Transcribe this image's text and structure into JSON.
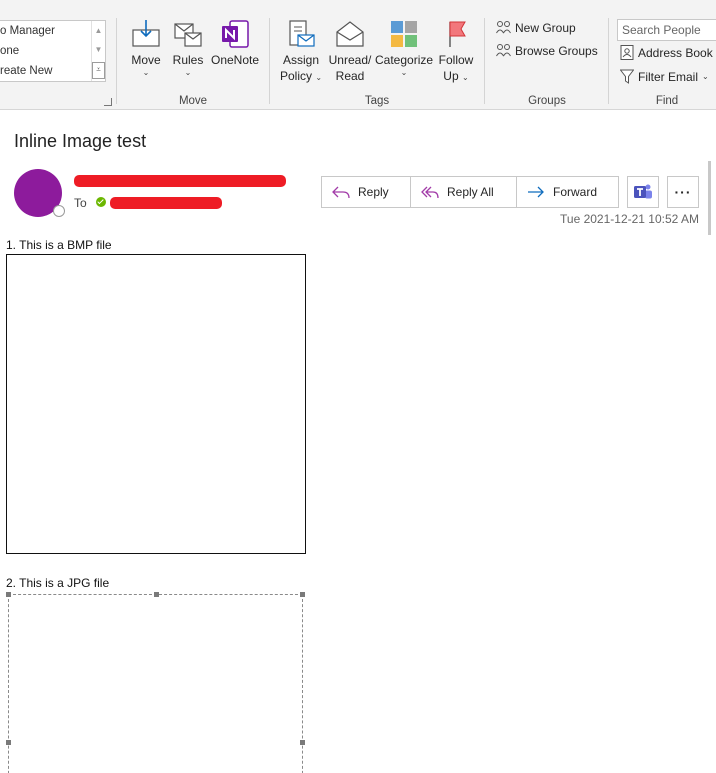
{
  "ribbon": {
    "quick_steps": {
      "items": [
        "o Manager",
        "one",
        "reate New"
      ],
      "scroll_up": "▲",
      "scroll_down": "▼",
      "more": "⩡"
    },
    "move_group": {
      "label": "Move",
      "move": "Move",
      "rules": "Rules",
      "onenote": "OneNote"
    },
    "tags_group": {
      "label": "Tags",
      "assign_policy": [
        "Assign",
        "Policy"
      ],
      "unread_read": [
        "Unread/",
        "Read"
      ],
      "categorize": "Categorize",
      "follow_up": [
        "Follow",
        "Up"
      ]
    },
    "groups_group": {
      "label": "Groups",
      "new_group": "New Group",
      "browse_groups": "Browse Groups"
    },
    "find_group": {
      "label": "Find",
      "search_people_placeholder": "Search People",
      "address_book": "Address Book",
      "filter_email": "Filter Email"
    },
    "caret": "⌄"
  },
  "message": {
    "subject": "Inline Image test",
    "to_label": "To",
    "actions": {
      "reply": "Reply",
      "reply_all": "Reply All",
      "forward": "Forward"
    },
    "more_label": "···",
    "timestamp": "Tue 2021-12-21 10:52 AM",
    "body": {
      "line1": "1. This is a BMP file",
      "line2": "2. This is a JPG file"
    }
  },
  "colors": {
    "avatar": "#8d1b9c",
    "redaction": "#ee1c25",
    "teams": "#4b53bc",
    "onenote": "#7719aa",
    "forward_arrow": "#0f6cbd",
    "reply_all_arrow": "#a23ca8"
  }
}
